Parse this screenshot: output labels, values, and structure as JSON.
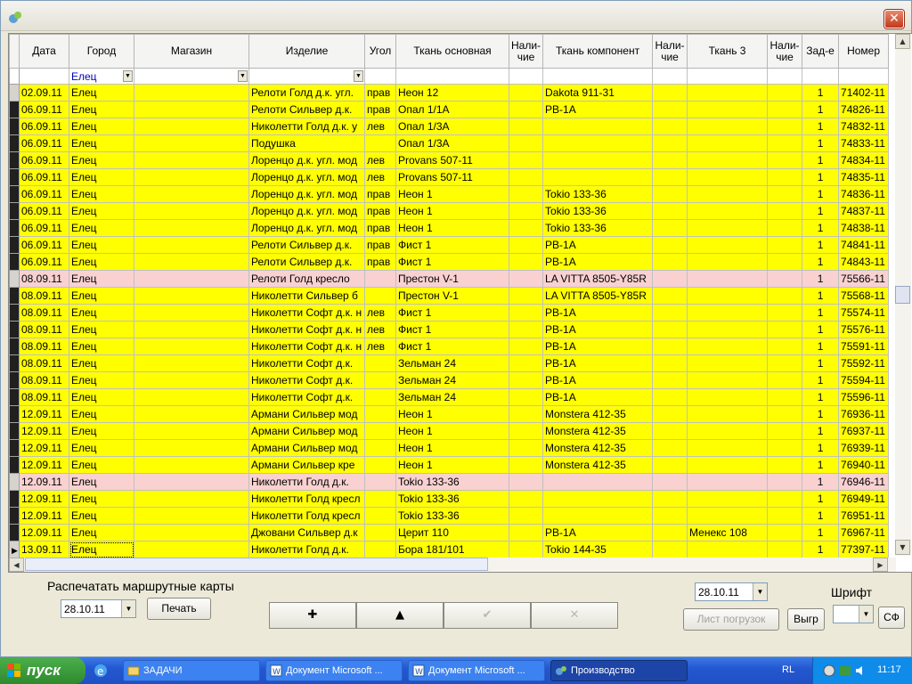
{
  "window": {
    "close_label": "✕"
  },
  "grid": {
    "columns": [
      {
        "label": "Дата"
      },
      {
        "label": "Город"
      },
      {
        "label": "Магазин"
      },
      {
        "label": "Изделие"
      },
      {
        "label": "Угол"
      },
      {
        "label": "Ткань основная"
      },
      {
        "label": "Нали-чие"
      },
      {
        "label": "Ткань компонент"
      },
      {
        "label": "Нали-чие"
      },
      {
        "label": "Ткань 3"
      },
      {
        "label": "Нали-чие"
      },
      {
        "label": "Зад-е"
      },
      {
        "label": "Номер"
      }
    ],
    "filter": {
      "city": "Елец"
    },
    "rows": [
      {
        "date": "02.09.11",
        "city": "Елец",
        "shop": "",
        "item": "Релоти Голд д.к. угл.",
        "corner": "прав",
        "fabric_main": "Неон 12",
        "avail1": "",
        "fabric_comp": "Dakota 911-31",
        "avail2": "",
        "fabric3": "",
        "avail3": "",
        "zad": "1",
        "num": "71402-11",
        "pink": false
      },
      {
        "date": "06.09.11",
        "city": "Елец",
        "shop": "",
        "item": "Релоти Сильвер д.к.",
        "corner": "прав",
        "fabric_main": "Опал 1/1А",
        "avail1": "",
        "fabric_comp": "РВ-1А",
        "avail2": "",
        "fabric3": "",
        "avail3": "",
        "zad": "1",
        "num": "74826-11",
        "pink": false
      },
      {
        "date": "06.09.11",
        "city": "Елец",
        "shop": "",
        "item": "Николетти Голд д.к. у",
        "corner": "лев",
        "fabric_main": "Опал 1/3А",
        "avail1": "",
        "fabric_comp": "",
        "avail2": "",
        "fabric3": "",
        "avail3": "",
        "zad": "1",
        "num": "74832-11",
        "pink": false
      },
      {
        "date": "06.09.11",
        "city": "Елец",
        "shop": "",
        "item": "Подушка",
        "corner": "",
        "fabric_main": "Опал 1/3А",
        "avail1": "",
        "fabric_comp": "",
        "avail2": "",
        "fabric3": "",
        "avail3": "",
        "zad": "1",
        "num": "74833-11",
        "pink": false
      },
      {
        "date": "06.09.11",
        "city": "Елец",
        "shop": "",
        "item": "Лоренцо д.к. угл. мод",
        "corner": "лев",
        "fabric_main": "Provans 507-11",
        "avail1": "",
        "fabric_comp": "",
        "avail2": "",
        "fabric3": "",
        "avail3": "",
        "zad": "1",
        "num": "74834-11",
        "pink": false
      },
      {
        "date": "06.09.11",
        "city": "Елец",
        "shop": "",
        "item": "Лоренцо д.к. угл. мод",
        "corner": "лев",
        "fabric_main": "Provans 507-11",
        "avail1": "",
        "fabric_comp": "",
        "avail2": "",
        "fabric3": "",
        "avail3": "",
        "zad": "1",
        "num": "74835-11",
        "pink": false
      },
      {
        "date": "06.09.11",
        "city": "Елец",
        "shop": "",
        "item": "Лоренцо д.к. угл. мод",
        "corner": "прав",
        "fabric_main": "Неон 1",
        "avail1": "",
        "fabric_comp": "Tokio 133-36",
        "avail2": "",
        "fabric3": "",
        "avail3": "",
        "zad": "1",
        "num": "74836-11",
        "pink": false
      },
      {
        "date": "06.09.11",
        "city": "Елец",
        "shop": "",
        "item": "Лоренцо д.к. угл. мод",
        "corner": "прав",
        "fabric_main": "Неон 1",
        "avail1": "",
        "fabric_comp": "Tokio 133-36",
        "avail2": "",
        "fabric3": "",
        "avail3": "",
        "zad": "1",
        "num": "74837-11",
        "pink": false
      },
      {
        "date": "06.09.11",
        "city": "Елец",
        "shop": "",
        "item": "Лоренцо д.к. угл. мод",
        "corner": "прав",
        "fabric_main": "Неон 1",
        "avail1": "",
        "fabric_comp": "Tokio 133-36",
        "avail2": "",
        "fabric3": "",
        "avail3": "",
        "zad": "1",
        "num": "74838-11",
        "pink": false
      },
      {
        "date": "06.09.11",
        "city": "Елец",
        "shop": "",
        "item": "Релоти Сильвер д.к.",
        "corner": "прав",
        "fabric_main": "Фист 1",
        "avail1": "",
        "fabric_comp": "РВ-1А",
        "avail2": "",
        "fabric3": "",
        "avail3": "",
        "zad": "1",
        "num": "74841-11",
        "pink": false
      },
      {
        "date": "06.09.11",
        "city": "Елец",
        "shop": "",
        "item": "Релоти Сильвер д.к.",
        "corner": "прав",
        "fabric_main": "Фист 1",
        "avail1": "",
        "fabric_comp": "РВ-1А",
        "avail2": "",
        "fabric3": "",
        "avail3": "",
        "zad": "1",
        "num": "74843-11",
        "pink": false
      },
      {
        "date": "08.09.11",
        "city": "Елец",
        "shop": "",
        "item": "Релоти Голд кресло",
        "corner": "",
        "fabric_main": "Престон V-1",
        "avail1": "",
        "fabric_comp": "LA VITTA 8505-Y85R",
        "avail2": "",
        "fabric3": "",
        "avail3": "",
        "zad": "1",
        "num": "75566-11",
        "pink": true
      },
      {
        "date": "08.09.11",
        "city": "Елец",
        "shop": "",
        "item": "Николетти Сильвер б",
        "corner": "",
        "fabric_main": "Престон V-1",
        "avail1": "",
        "fabric_comp": "LA VITTA 8505-Y85R",
        "avail2": "",
        "fabric3": "",
        "avail3": "",
        "zad": "1",
        "num": "75568-11",
        "pink": false
      },
      {
        "date": "08.09.11",
        "city": "Елец",
        "shop": "",
        "item": "Николетти Софт д.к. н",
        "corner": "лев",
        "fabric_main": "Фист 1",
        "avail1": "",
        "fabric_comp": "РВ-1А",
        "avail2": "",
        "fabric3": "",
        "avail3": "",
        "zad": "1",
        "num": "75574-11",
        "pink": false
      },
      {
        "date": "08.09.11",
        "city": "Елец",
        "shop": "",
        "item": "Николетти Софт д.к. н",
        "corner": "лев",
        "fabric_main": "Фист 1",
        "avail1": "",
        "fabric_comp": "РВ-1А",
        "avail2": "",
        "fabric3": "",
        "avail3": "",
        "zad": "1",
        "num": "75576-11",
        "pink": false
      },
      {
        "date": "08.09.11",
        "city": "Елец",
        "shop": "",
        "item": "Николетти Софт д.к. н",
        "corner": "лев",
        "fabric_main": "Фист 1",
        "avail1": "",
        "fabric_comp": "РВ-1А",
        "avail2": "",
        "fabric3": "",
        "avail3": "",
        "zad": "1",
        "num": "75591-11",
        "pink": false
      },
      {
        "date": "08.09.11",
        "city": "Елец",
        "shop": "",
        "item": "Николетти Софт д.к.",
        "corner": "",
        "fabric_main": "Зельман 24",
        "avail1": "",
        "fabric_comp": "РВ-1А",
        "avail2": "",
        "fabric3": "",
        "avail3": "",
        "zad": "1",
        "num": "75592-11",
        "pink": false
      },
      {
        "date": "08.09.11",
        "city": "Елец",
        "shop": "",
        "item": "Николетти Софт д.к.",
        "corner": "",
        "fabric_main": "Зельман 24",
        "avail1": "",
        "fabric_comp": "РВ-1А",
        "avail2": "",
        "fabric3": "",
        "avail3": "",
        "zad": "1",
        "num": "75594-11",
        "pink": false
      },
      {
        "date": "08.09.11",
        "city": "Елец",
        "shop": "",
        "item": "Николетти Софт д.к.",
        "corner": "",
        "fabric_main": "Зельман 24",
        "avail1": "",
        "fabric_comp": "РВ-1А",
        "avail2": "",
        "fabric3": "",
        "avail3": "",
        "zad": "1",
        "num": "75596-11",
        "pink": false
      },
      {
        "date": "12.09.11",
        "city": "Елец",
        "shop": "",
        "item": "Армани Сильвер мод",
        "corner": "",
        "fabric_main": "Неон 1",
        "avail1": "",
        "fabric_comp": "Monstera 412-35",
        "avail2": "",
        "fabric3": "",
        "avail3": "",
        "zad": "1",
        "num": "76936-11",
        "pink": false
      },
      {
        "date": "12.09.11",
        "city": "Елец",
        "shop": "",
        "item": "Армани Сильвер мод",
        "corner": "",
        "fabric_main": "Неон 1",
        "avail1": "",
        "fabric_comp": "Monstera 412-35",
        "avail2": "",
        "fabric3": "",
        "avail3": "",
        "zad": "1",
        "num": "76937-11",
        "pink": false
      },
      {
        "date": "12.09.11",
        "city": "Елец",
        "shop": "",
        "item": "Армани Сильвер мод",
        "corner": "",
        "fabric_main": "Неон 1",
        "avail1": "",
        "fabric_comp": "Monstera 412-35",
        "avail2": "",
        "fabric3": "",
        "avail3": "",
        "zad": "1",
        "num": "76939-11",
        "pink": false
      },
      {
        "date": "12.09.11",
        "city": "Елец",
        "shop": "",
        "item": "Армани Сильвер кре",
        "corner": "",
        "fabric_main": "Неон 1",
        "avail1": "",
        "fabric_comp": "Monstera 412-35",
        "avail2": "",
        "fabric3": "",
        "avail3": "",
        "zad": "1",
        "num": "76940-11",
        "pink": false
      },
      {
        "date": "12.09.11",
        "city": "Елец",
        "shop": "",
        "item": "Николетти Голд д.к.",
        "corner": "",
        "fabric_main": "Tokio 133-36",
        "avail1": "",
        "fabric_comp": "",
        "avail2": "",
        "fabric3": "",
        "avail3": "",
        "zad": "1",
        "num": "76946-11",
        "pink": true
      },
      {
        "date": "12.09.11",
        "city": "Елец",
        "shop": "",
        "item": "Николетти Голд кресл",
        "corner": "",
        "fabric_main": "Tokio 133-36",
        "avail1": "",
        "fabric_comp": "",
        "avail2": "",
        "fabric3": "",
        "avail3": "",
        "zad": "1",
        "num": "76949-11",
        "pink": false
      },
      {
        "date": "12.09.11",
        "city": "Елец",
        "shop": "",
        "item": "Николетти Голд кресл",
        "corner": "",
        "fabric_main": "Tokio 133-36",
        "avail1": "",
        "fabric_comp": "",
        "avail2": "",
        "fabric3": "",
        "avail3": "",
        "zad": "1",
        "num": "76951-11",
        "pink": false
      },
      {
        "date": "12.09.11",
        "city": "Елец",
        "shop": "",
        "item": "Джовани Сильвер д.к",
        "corner": "",
        "fabric_main": "Церит 110",
        "avail1": "",
        "fabric_comp": "РВ-1А",
        "avail2": "",
        "fabric3": "Менекс 108",
        "avail3": "",
        "zad": "1",
        "num": "76967-11",
        "pink": false
      },
      {
        "date": "13.09.11",
        "city": "Елец",
        "shop": "",
        "item": "Николетти Голд д.к.",
        "corner": "",
        "fabric_main": "Бора 181/101",
        "avail1": "",
        "fabric_comp": "Tokio 144-35",
        "avail2": "",
        "fabric3": "",
        "avail3": "",
        "zad": "1",
        "num": "77397-11",
        "pink": false
      }
    ]
  },
  "bottom": {
    "print_routes_label": "Распечатать маршрутные карты",
    "route_date": "28.10.11",
    "print_button": "Печать",
    "nav_add": "✚",
    "nav_up": "▲",
    "nav_ok": "✔",
    "nav_cancel": "✕",
    "load_date": "28.10.11",
    "load_sheet_button": "Лист погрузок",
    "vygr_button": "Выгр",
    "font_label": "Шрифт",
    "font_value": "",
    "sf_button": "СФ"
  },
  "taskbar": {
    "start_label": "пуск",
    "buttons": [
      {
        "label": "ЗАДАЧИ"
      },
      {
        "label": "Документ Microsoft ..."
      },
      {
        "label": "Документ Microsoft ..."
      },
      {
        "label": "Производство"
      }
    ],
    "lang": "RL",
    "clock": "11:17"
  },
  "colors": {
    "row_yellow": "#ffff00",
    "row_pink": "#f9d1d1",
    "taskbar_blue": "#2458d0",
    "start_green": "#3a9a3a"
  }
}
